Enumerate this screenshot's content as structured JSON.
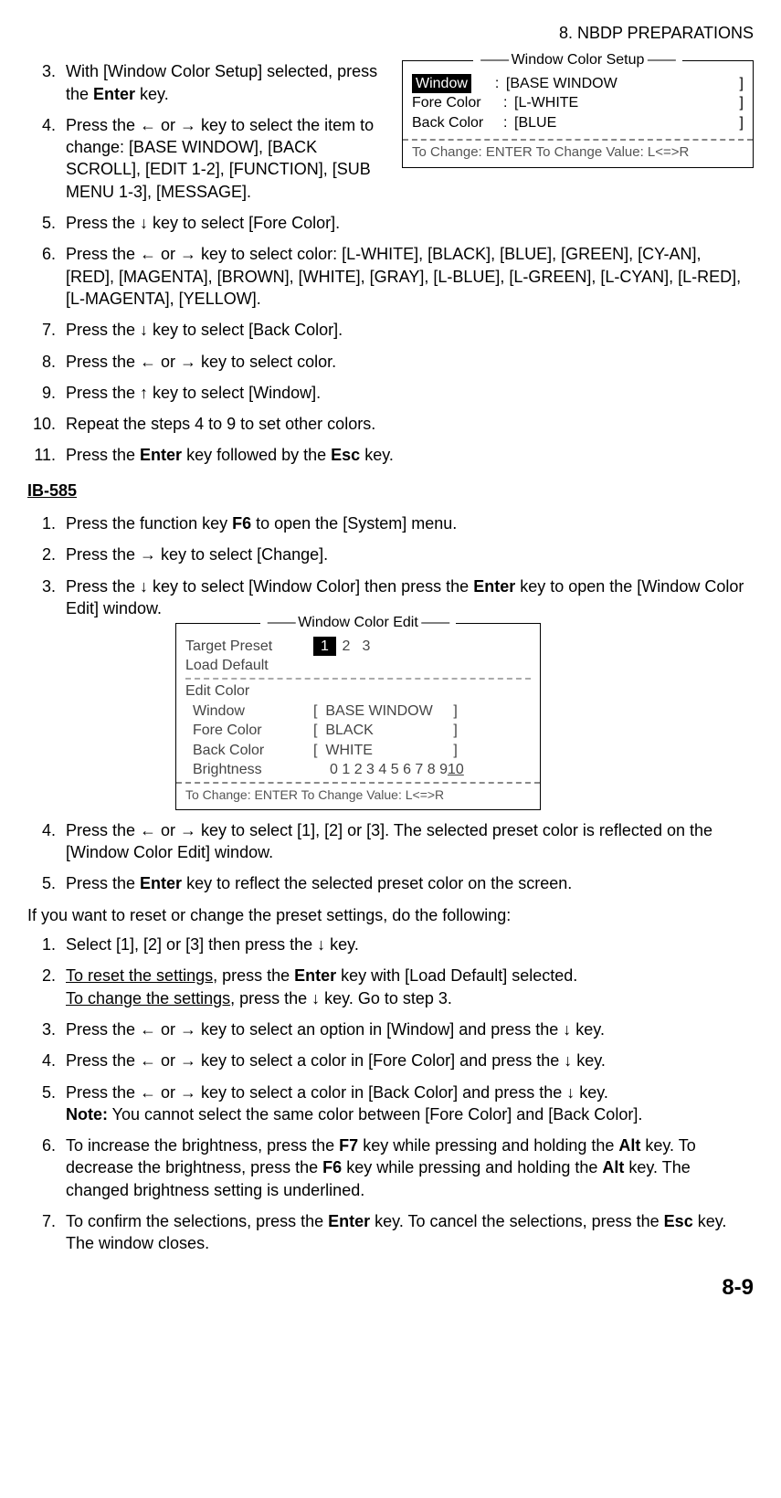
{
  "header": "8.  NBDP PREPARATIONS",
  "page_number": "8-9",
  "steps_a": {
    "s3_a": "With [Window Color Setup] selected, press the ",
    "s3_b": " key.",
    "s4": "Press the ← or → key to select the item to change: [BASE WINDOW], [BACK SCROLL], [EDIT 1-2], [FUNCTION], [SUB MENU 1-3], [MESSAGE].",
    "s5": "Press the ↓ key to select [Fore Color].",
    "s6": "Press the ← or → key to select color: [L-WHITE], [BLACK], [BLUE], [GREEN], [CY-AN], [RED], [MAGENTA], [BROWN], [WHITE], [GRAY], [L-BLUE], [L-GREEN], [L-CYAN], [L-RED], [L-MAGENTA], [YELLOW].",
    "s7": "Press the ↓ key to select [Back Color].",
    "s8": "Press the ← or → key to select color.",
    "s9": "Press the ↑ key to select [Window].",
    "s10": "Repeat the steps 4 to 9 to set other colors.",
    "s11_a": "Press the ",
    "s11_b": " key followed by the ",
    "s11_c": " key."
  },
  "enter": "Enter",
  "esc": "Esc",
  "f6": "F6",
  "f7": "F7",
  "alt": "Alt",
  "heading_ib": "IB-585",
  "steps_b": {
    "s1_a": "Press the function key ",
    "s1_b": " to open the [System] menu.",
    "s2": "Press the → key to select [Change].",
    "s3_a": "Press the ↓ key to select [Window Color] then press the ",
    "s3_b": " key to open the [Window Color Edit] window.",
    "s4": "Press the ← or → key to select [1], [2] or [3]. The selected preset color is reflected on the [Window Color Edit] window.",
    "s5_a": "Press the ",
    "s5_b": " key to reflect the selected preset color on the screen."
  },
  "note1": "If you want to reset or change the preset settings, do the following:",
  "steps_c": {
    "s1": "Select [1], [2] or [3] then press the ↓ key.",
    "s2_u1": "To reset the settings",
    "s2_a": ", press the ",
    "s2_b": " key with [Load Default] selected.",
    "s2_u2": "To change the settings",
    "s2_c": ", press the ↓ key. Go to step 3.",
    "s3": "Press the ← or → key to select an option in [Window] and press the ↓ key.",
    "s4": "Press the ← or → key to select a color in [Fore Color] and press the ↓ key.",
    "s5": "Press the ← or → key to select a color in [Back Color] and press the ↓ key.",
    "s5_note_lbl": "Note:",
    "s5_note": " You cannot select the same color between [Fore Color] and [Back Color].",
    "s6_a": "To increase the brightness, press the ",
    "s6_b": " key while pressing and holding the ",
    "s6_c": " key. To decrease the brightness, press the ",
    "s6_d": " key while pressing and holding the ",
    "s6_e": " key. The changed brightness setting is underlined.",
    "s7_a": "To confirm the selections, press the ",
    "s7_b": " key. To cancel the selections, press the ",
    "s7_c": " key. The window closes."
  },
  "fig1": {
    "title": "Window Color Setup",
    "row1_label": "Window",
    "row1_val": "BASE WINDOW",
    "row2_label": "Fore Color",
    "row2_val": "L-WHITE",
    "row3_label": "Back Color",
    "row3_val": "BLUE",
    "footer": "To Change: ENTER    To Change Value: L<=>R"
  },
  "fig2": {
    "title": "Window Color Edit",
    "target_preset": "Target Preset",
    "p1": "1",
    "p2": "2",
    "p3": "3",
    "load_default": "Load Default",
    "edit_color": "Edit Color",
    "window": "Window",
    "window_val": "BASE WINDOW",
    "fore": "Fore Color",
    "fore_val": "BLACK",
    "back": "Back Color",
    "back_val": "WHITE",
    "bright": "Brightness",
    "bright_vals": "0 1 2 3 4 5 6 7 8 9 ",
    "bright_sel": "10",
    "footer": "To Change: ENTER    To Change Value: L<=>R"
  }
}
